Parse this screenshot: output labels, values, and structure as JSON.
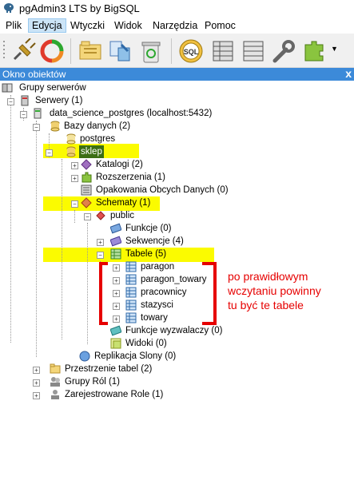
{
  "window": {
    "title": "pgAdmin3 LTS by BigSQL"
  },
  "menu": [
    "Plik",
    "Edycja",
    "Wtyczki",
    "Widok",
    "Narzędzia",
    "Pomoc"
  ],
  "toolbar": [
    "connect-icon",
    "refresh-icon",
    "open-folder-icon",
    "properties-icon",
    "trash-icon",
    "sql-icon",
    "grid-icon",
    "filter-icon",
    "tool-icon",
    "plugin-icon"
  ],
  "panel": {
    "title": "Okno obiektów",
    "close": "x"
  },
  "tree": {
    "root": "Grupy serwerów",
    "servers": "Serwery (1)",
    "server": "data_science_postgres (localhost:5432)",
    "databases": "Bazy danych (2)",
    "db_postgres": "postgres",
    "db_sklep": "sklep",
    "catalogs": "Katalogi (2)",
    "extensions": "Rozszerzenia (1)",
    "fdw": "Opakowania Obcych Danych (0)",
    "schemas": "Schematy (1)",
    "public": "public",
    "functions": "Funkcje (0)",
    "sequences": "Sekwencje (4)",
    "tables": "Tabele (5)",
    "table_list": [
      "paragon",
      "paragon_towary",
      "pracownicy",
      "stazysci",
      "towary"
    ],
    "trigger_functions": "Funkcje wyzwalaczy (0)",
    "views": "Widoki (0)",
    "replication": "Replikacja Slony (0)",
    "tablespaces": "Przestrzenie tabel (2)",
    "group_roles": "Grupy Ról (1)",
    "login_roles": "Zarejestrowane Role (1)"
  },
  "annotation": [
    "po prawidłowym",
    "wczytaniu powinny",
    "tu być te tabele"
  ],
  "colors": {
    "highlight": "#fbfb00",
    "annotation": "#e60000",
    "panel_header": "#3c8ad9"
  }
}
